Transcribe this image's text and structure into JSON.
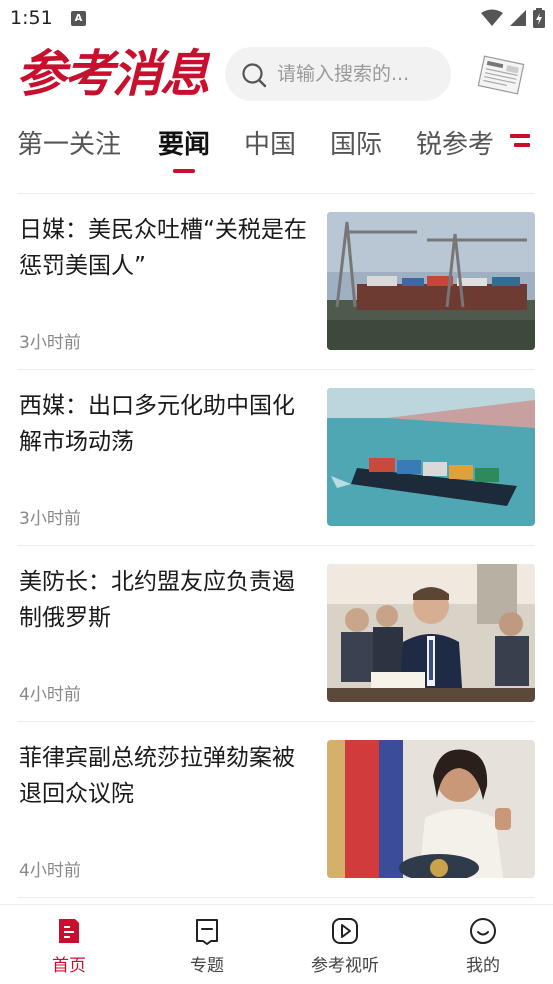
{
  "status_bar": {
    "time": "1:51",
    "notif_letter": "A"
  },
  "header": {
    "logo_text": "参考消息",
    "search_placeholder": "请输入搜索的..."
  },
  "tabs": [
    {
      "label": "第一关注"
    },
    {
      "label": "要闻"
    },
    {
      "label": "中国"
    },
    {
      "label": "国际"
    },
    {
      "label": "锐参考"
    }
  ],
  "active_tab": "要闻",
  "news": [
    {
      "title": "日媒：美民众吐槽“关税是在惩罚美国人”",
      "time": "3小时前",
      "thumb": "port-cranes"
    },
    {
      "title": "西媒：出口多元化助中国化解市场动荡",
      "time": "3小时前",
      "thumb": "container-ship"
    },
    {
      "title": "美防长：北约盟友应负责遏制俄罗斯",
      "time": "4小时前",
      "thumb": "hearing"
    },
    {
      "title": "菲律宾副总统莎拉弹劾案被退回众议院",
      "time": "4小时前",
      "thumb": "podium"
    }
  ],
  "bottom_nav": [
    {
      "label": "首页",
      "icon": "home-doc-icon",
      "active": true
    },
    {
      "label": "专题",
      "icon": "bookmark-icon",
      "active": false
    },
    {
      "label": "参考视听",
      "icon": "play-icon",
      "active": false
    },
    {
      "label": "我的",
      "icon": "smile-icon",
      "active": false
    }
  ],
  "colors": {
    "accent": "#c8102e",
    "text": "#1a1a1a",
    "muted": "#888888"
  }
}
